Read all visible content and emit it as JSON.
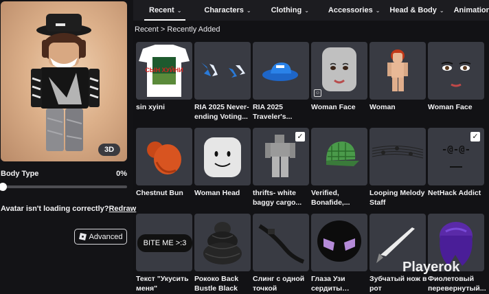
{
  "tabs": [
    {
      "label": "Recent",
      "chevron": true,
      "active": true
    },
    {
      "label": "Characters",
      "chevron": true,
      "active": false
    },
    {
      "label": "Clothing",
      "chevron": true,
      "active": false
    },
    {
      "label": "Accessories",
      "chevron": true,
      "active": false
    },
    {
      "label": "Head & Body",
      "chevron": true,
      "active": false
    },
    {
      "label": "Animations",
      "chevron": false,
      "active": false
    }
  ],
  "breadcrumb": {
    "root": "Recent",
    "separator": ">",
    "current": "Recently Added"
  },
  "avatar": {
    "view_mode_label": "3D"
  },
  "body_type": {
    "label": "Body Type",
    "value": "0%",
    "level": 0
  },
  "loading": {
    "prompt": "Avatar isn't loading correctly?",
    "link": "Redraw"
  },
  "advanced": {
    "label": "Advanced"
  },
  "items": [
    {
      "name": "sin xyini",
      "icon": "tshirt-icon",
      "checked": false
    },
    {
      "name": "RIA 2025 Never-ending Voting...",
      "icon": "blue-wings-icon",
      "checked": false
    },
    {
      "name": "RIA 2025 Traveler's...",
      "icon": "blue-hat-icon",
      "checked": false
    },
    {
      "name": "Woman Face",
      "icon": "woman-face-head-icon",
      "checked": false,
      "badge": true
    },
    {
      "name": "Woman",
      "icon": "woman-figure-icon",
      "checked": false
    },
    {
      "name": "Woman Face",
      "icon": "woman-face-icon",
      "checked": false
    },
    {
      "name": "Chestnut Bun",
      "icon": "chestnut-hair-icon",
      "checked": false
    },
    {
      "name": "Woman Head",
      "icon": "white-head-icon",
      "checked": false
    },
    {
      "name": "thrifts- white baggy cargo...",
      "icon": "cargo-pants-icon",
      "checked": true
    },
    {
      "name": "Verified, Bonafide,...",
      "icon": "plaid-cap-icon",
      "checked": false
    },
    {
      "name": "Looping Melody Staff",
      "icon": "music-staff-icon",
      "checked": false
    },
    {
      "name": "NetHack Addict",
      "icon": "nethack-face-icon",
      "checked": true,
      "face_text": "-@-@-"
    },
    {
      "name": "Текст \"Укусить меня\"",
      "icon": "text-bubble-icon",
      "checked": false,
      "bubble_text": "BITE ME >:3"
    },
    {
      "name": "Рококо Back Bustle Black",
      "icon": "black-bustle-icon",
      "checked": false
    },
    {
      "name": "Слинг с одной точкой",
      "icon": "sling-icon",
      "checked": false
    },
    {
      "name": "Глаза Узи сердиты (Дрон...",
      "icon": "uzi-eyes-icon",
      "checked": false
    },
    {
      "name": "Зубчатый нож в рот",
      "icon": "knife-icon",
      "checked": false
    },
    {
      "name": "Фиолетовый перевернутый...",
      "icon": "purple-hair-icon",
      "checked": false
    }
  ],
  "watermark": "Playerok",
  "tshirt_text": "СЫН ХУЙНИ",
  "colors": {
    "background": "#121215",
    "tab_bar": "#1c1c20",
    "card": "#393b43",
    "accent": "#ffffff"
  }
}
